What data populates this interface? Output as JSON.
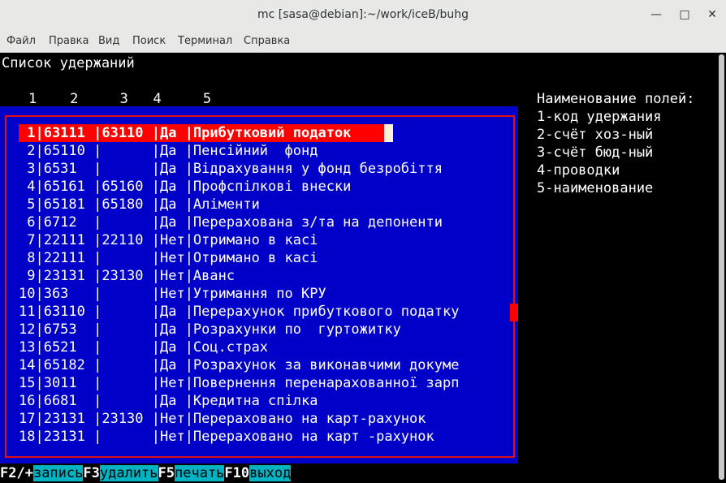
{
  "window": {
    "title": "mc [sasa@debian]:~/work/iceB/buhg",
    "minimize": "—",
    "maximize": "□",
    "close": "✕"
  },
  "menu": [
    "Файл",
    "Правка",
    "Вид",
    "Поиск",
    "Терминал",
    "Справка"
  ],
  "screen": {
    "heading": "Список удержаний",
    "column_numbers": "1    2     3   4     5",
    "legend": {
      "title": "Наименование полей:",
      "items": [
        "1-код удержания",
        "2-счёт хоз-ный",
        "3-счёт бюд-ный",
        "4-проводки",
        "5-наименование"
      ]
    }
  },
  "table": {
    "rows": [
      " 1|63111 |63110 |Да |Прибутковий податок",
      " 2|65110 |      |Да |Пенсійний  фонд",
      " 3|6531  |      |Да |Відрахування у фонд безробіття",
      " 4|65161 |65160 |Да |Профспілкові внески",
      " 5|65181 |65180 |Да |Аліменти",
      " 6|6712  |      |Да |Перерахована з/та на депоненти",
      " 7|22111 |22110 |Нет|Отримано в касі",
      " 8|22111 |      |Нет|Отримано в касі",
      " 9|23131 |23130 |Нет|Аванс",
      "10|363   |      |Нет|Утримання по КРУ",
      "11|63110 |      |Да |Перерахунок прибуткового податку",
      "12|6753  |      |Да |Розрахунки по  гуртожитку",
      "13|6521  |      |Да |Соц.страх",
      "14|65182 |      |Да |Розрахунок за виконавчими докуме",
      "15|3011  |      |Нет|Повернення перенарахованної зарп",
      "16|6681  |      |Да |Кредитна спілка",
      "17|23131 |23130 |Нет|Перераховано на карт-рахунок",
      "18|23131 |      |Нет|Перераховано на карт -рахунок"
    ]
  },
  "fkeys": [
    {
      "key": "F2/+",
      "label": "запись"
    },
    {
      "key": "F3",
      "label": "удалить"
    },
    {
      "key": "F5",
      "label": "печать"
    },
    {
      "key": "F10",
      "label": "выход"
    }
  ]
}
